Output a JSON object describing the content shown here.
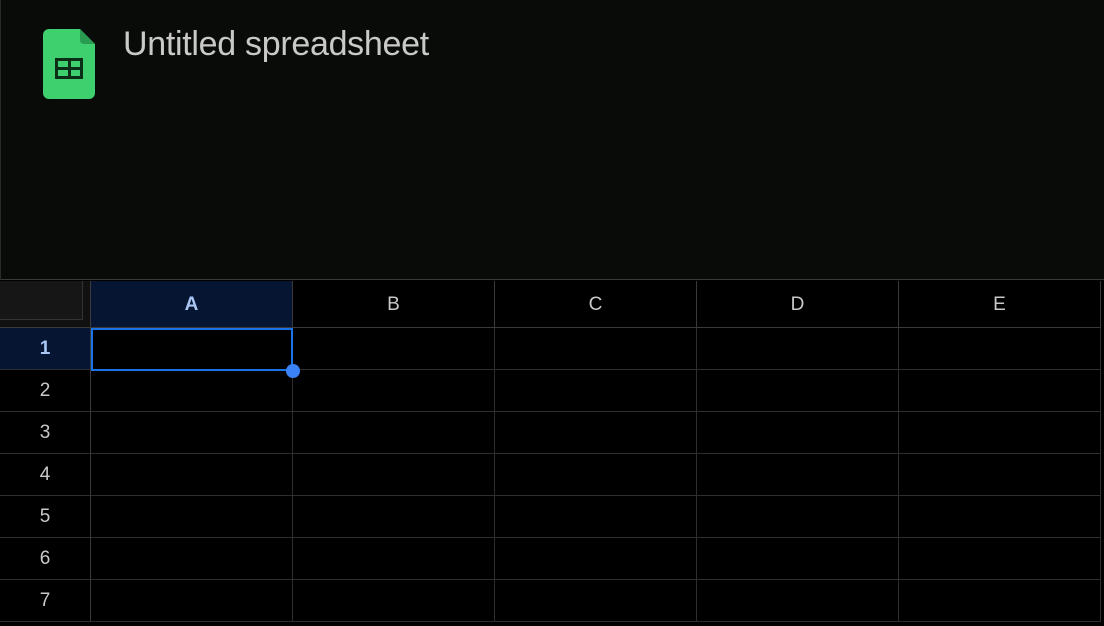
{
  "app": {
    "title": "Untitled spreadsheet",
    "logo_icon": "google-sheets-icon",
    "logo_color": "#3ecf6e"
  },
  "grid": {
    "columns": [
      "A",
      "B",
      "C",
      "D",
      "E"
    ],
    "rows": [
      "1",
      "2",
      "3",
      "4",
      "5",
      "6",
      "7"
    ],
    "selected_column": "A",
    "selected_row": "1",
    "active_cell": "A1",
    "selection_color": "#1a73e8"
  }
}
